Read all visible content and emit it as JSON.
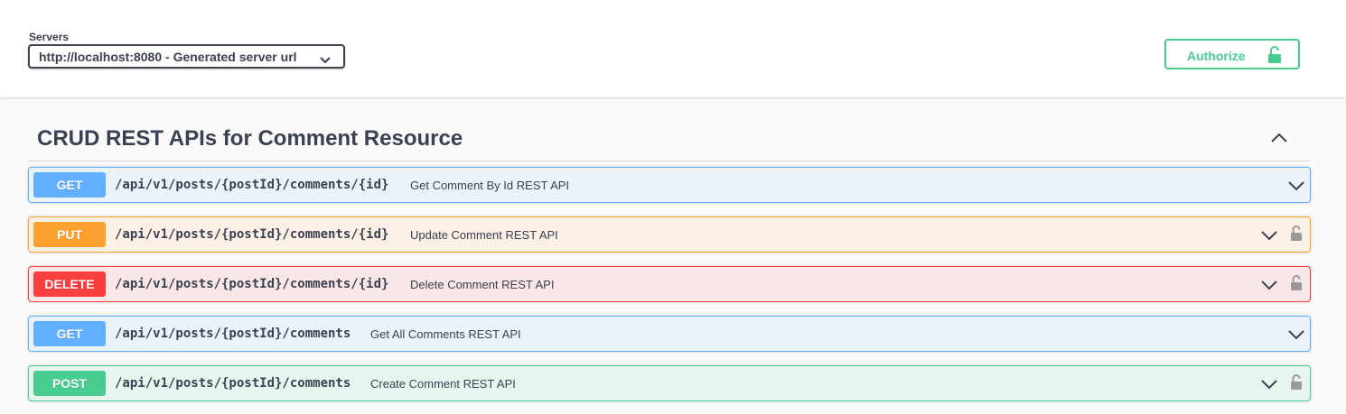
{
  "servers": {
    "label": "Servers",
    "selected": "http://localhost:8080 - Generated server url"
  },
  "authorize": {
    "label": "Authorize",
    "color": "#49cc90"
  },
  "tag": {
    "title": "CRUD REST APIs for Comment Resource",
    "expanded": true
  },
  "operations": [
    {
      "method": "GET",
      "path": "/api/v1/posts/{postId}/comments/{id}",
      "summary": "Get Comment By Id REST API",
      "locked": false,
      "color": "#61affe"
    },
    {
      "method": "PUT",
      "path": "/api/v1/posts/{postId}/comments/{id}",
      "summary": "Update Comment REST API",
      "locked": true,
      "color": "#fca130"
    },
    {
      "method": "DELETE",
      "path": "/api/v1/posts/{postId}/comments/{id}",
      "summary": "Delete Comment REST API",
      "locked": true,
      "color": "#f93e3e"
    },
    {
      "method": "GET",
      "path": "/api/v1/posts/{postId}/comments",
      "summary": "Get All Comments REST API",
      "locked": false,
      "color": "#61affe"
    },
    {
      "method": "POST",
      "path": "/api/v1/posts/{postId}/comments",
      "summary": "Create Comment REST API",
      "locked": true,
      "color": "#49cc90"
    }
  ]
}
